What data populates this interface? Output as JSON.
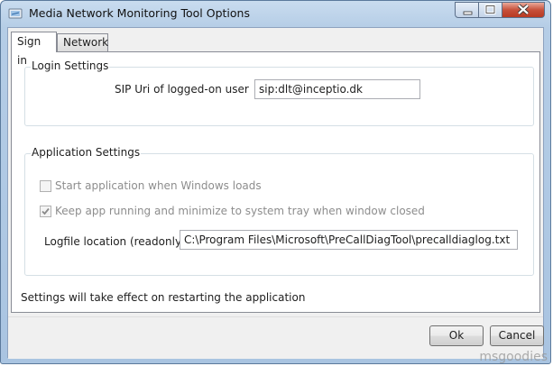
{
  "window": {
    "title": "Media Network Monitoring Tool Options",
    "icon": "network-app-icon",
    "controls": [
      "minimize-icon",
      "maximize-icon",
      "close-icon"
    ]
  },
  "tabs": [
    {
      "label": "Sign in",
      "selected": true
    },
    {
      "label": "Network",
      "selected": false
    }
  ],
  "login_settings": {
    "title": "Login Settings",
    "sip_label": "SIP Uri of logged-on user",
    "sip_value": "sip:dlt@inceptio.dk"
  },
  "application_settings": {
    "title": "Application Settings",
    "start_with_windows": {
      "label": "Start application when Windows loads",
      "checked": false,
      "enabled": false
    },
    "keep_running": {
      "label": "Keep app running and minimize to system tray when window closed",
      "checked": true,
      "enabled": false
    },
    "logfile_label": "Logfile location (readonly)",
    "logfile_value": "C:\\Program Files\\Microsoft\\PreCallDiagTool\\precalldiaglog.txt"
  },
  "note": "Settings will take effect on restarting the application",
  "buttons": {
    "ok": "Ok",
    "cancel": "Cancel"
  },
  "watermark": "msgoodies"
}
